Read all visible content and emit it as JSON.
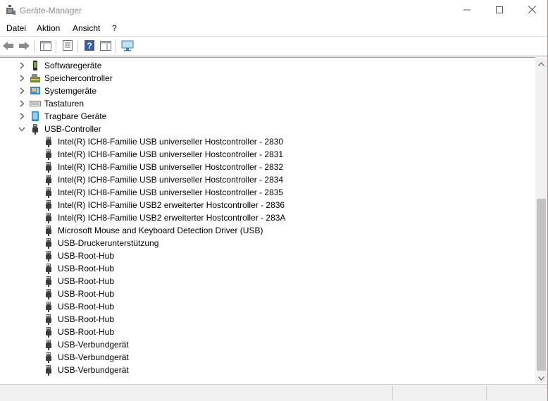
{
  "window": {
    "title": "Geräte-Manager",
    "minimize_icon": "minimize-icon",
    "maximize_icon": "maximize-icon",
    "close_icon": "close-icon"
  },
  "menu": {
    "items": [
      "Datei",
      "Aktion",
      "Ansicht",
      "?"
    ]
  },
  "toolbar": {
    "icons": [
      "back-icon",
      "forward-icon",
      "show-hide-console-tree-icon",
      "properties-icon",
      "help-icon",
      "action-pane-icon",
      "monitor-icon"
    ]
  },
  "tree": {
    "categories": [
      {
        "label": "Softwaregeräte",
        "icon": "software-device-icon",
        "expanded": false
      },
      {
        "label": "Speichercontroller",
        "icon": "storage-controller-icon",
        "expanded": false
      },
      {
        "label": "Systemgeräte",
        "icon": "system-device-icon",
        "expanded": false
      },
      {
        "label": "Tastaturen",
        "icon": "keyboard-icon",
        "expanded": false
      },
      {
        "label": "Tragbare Geräte",
        "icon": "portable-device-icon",
        "expanded": false
      },
      {
        "label": "USB-Controller",
        "icon": "usb-icon",
        "expanded": true
      }
    ],
    "usb_children": [
      "Intel(R) ICH8-Familie USB universeller Hostcontroller - 2830",
      "Intel(R) ICH8-Familie USB universeller Hostcontroller - 2831",
      "Intel(R) ICH8-Familie USB universeller Hostcontroller - 2832",
      "Intel(R) ICH8-Familie USB universeller Hostcontroller - 2834",
      "Intel(R) ICH8-Familie USB universeller Hostcontroller - 2835",
      "Intel(R) ICH8-Familie USB2 erweiterter Hostcontroller - 2836",
      "Intel(R) ICH8-Familie USB2 erweiterter Hostcontroller - 283A",
      "Microsoft Mouse and Keyboard Detection Driver (USB)",
      "USB-Druckerunterstützung",
      "USB-Root-Hub",
      "USB-Root-Hub",
      "USB-Root-Hub",
      "USB-Root-Hub",
      "USB-Root-Hub",
      "USB-Root-Hub",
      "USB-Root-Hub",
      "USB-Verbundgerät",
      "USB-Verbundgerät",
      "USB-Verbundgerät"
    ]
  },
  "colors": {
    "window_border_accent": "#e07a70",
    "usb_icon": "#3c3c3c",
    "scrollbar_thumb": "#c2c2c2"
  }
}
